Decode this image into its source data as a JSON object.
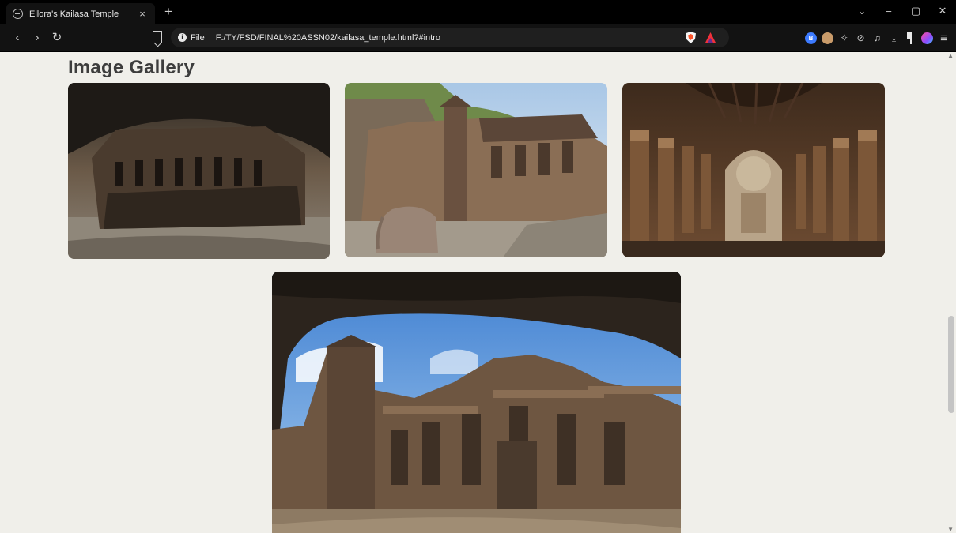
{
  "browser": {
    "tab": {
      "title": "Ellora's Kailasa Temple",
      "close": "×",
      "new_tab": "+"
    },
    "window_controls": {
      "dropdown": "⌄",
      "minimize": "−",
      "restore": "▢",
      "close": "✕"
    },
    "nav": {
      "back": "‹",
      "forward": "›",
      "reload": "↻"
    },
    "address": {
      "scheme_label": "File",
      "url": "F:/TY/FSD/FINAL%20ASSN02/kailasa_temple.html?#intro"
    },
    "extensions": [
      "brave-wallet-icon",
      "cookie-icon",
      "puzzle-icon",
      "leo-icon",
      "media-icon",
      "download-icon",
      "sidepanel-icon",
      "gem-icon",
      "menu-icon"
    ],
    "ext_glyphs": {
      "blue": "B",
      "puzzle": "✧",
      "leo": "⊘",
      "media": "♫",
      "download": "⤓",
      "menu": "≡"
    }
  },
  "page": {
    "gallery_title": "Image Gallery",
    "images": [
      {
        "subject": "Kailasa temple seen from cave opening"
      },
      {
        "subject": "Kailasa temple courtyard with elephant statue"
      },
      {
        "subject": "Vishvakarma cave chaitya hall"
      },
      {
        "subject": "Kailasa temple through rock arch"
      }
    ]
  },
  "colors": {
    "page_bg": "#f0efea",
    "title_text": "#3d3d3d",
    "chrome_bg": "#121212",
    "accent_red": "#fb542b"
  }
}
